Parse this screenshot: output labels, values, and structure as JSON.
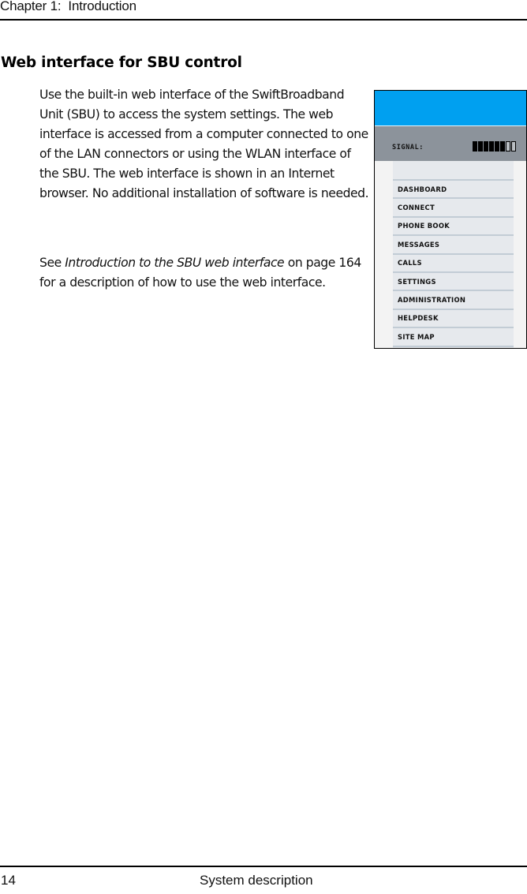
{
  "header": {
    "chapter": "Chapter 1:  Introduction"
  },
  "section": {
    "title": "Web interface for SBU control"
  },
  "body": {
    "paragraph1": "Use the built-in web interface of the SwiftBroadband Unit (SBU) to access the system settings. The web interface is accessed from a computer connected to one of the LAN connectors or using the WLAN interface of the SBU. The web interface is shown in an Internet browser. No additional installation of software is needed.",
    "paragraph2": {
      "prefix": "See ",
      "link_text": "Introduction to the SBU web interface",
      "suffix": " on page 164 for a description of how to use the web interface."
    }
  },
  "figure": {
    "banner_color": "#00a0f0",
    "signal": {
      "label": "SIGNAL:",
      "level": 6,
      "max": 8
    },
    "menu": [
      {
        "label": "DASHBOARD"
      },
      {
        "label": "CONNECT"
      },
      {
        "label": "PHONE BOOK"
      },
      {
        "label": "MESSAGES"
      },
      {
        "label": "CALLS"
      },
      {
        "label": "SETTINGS"
      },
      {
        "label": "ADMINISTRATION"
      },
      {
        "label": "HELPDESK"
      },
      {
        "label": "SITE MAP"
      }
    ]
  },
  "footer": {
    "page_number": "14",
    "section_name": "System description"
  }
}
